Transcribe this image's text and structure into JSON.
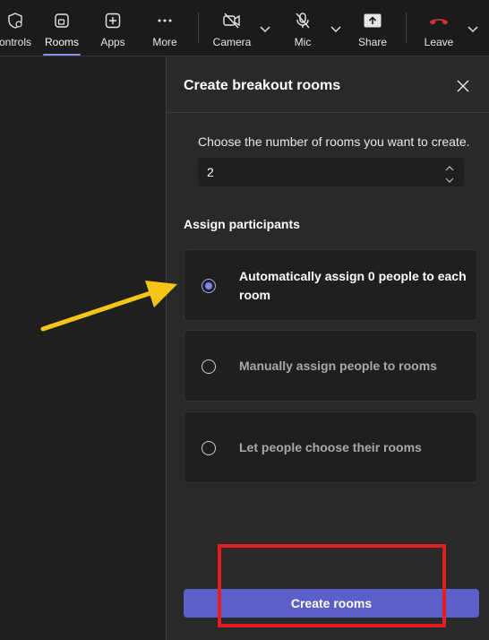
{
  "toolbar": {
    "items": [
      {
        "label": "ontrols",
        "icon": "shield-gear-icon"
      },
      {
        "label": "Rooms",
        "icon": "rooms-icon",
        "active": true
      },
      {
        "label": "Apps",
        "icon": "apps-plus-icon"
      },
      {
        "label": "More",
        "icon": "more-dots-icon"
      },
      {
        "label": "Camera",
        "icon": "camera-off-icon"
      },
      {
        "label": "Mic",
        "icon": "mic-off-icon"
      },
      {
        "label": "Share",
        "icon": "share-icon"
      },
      {
        "label": "Leave",
        "icon": "leave-phone-icon"
      }
    ]
  },
  "panel": {
    "title": "Create breakout rooms",
    "rooms_prompt": "Choose the number of rooms you want to create.",
    "rooms_value": "2",
    "assign_heading": "Assign participants",
    "options": [
      {
        "label": "Automatically assign 0 people to each room",
        "selected": true
      },
      {
        "label": "Manually assign people to rooms",
        "selected": false
      },
      {
        "label": "Let people choose their rooms",
        "selected": false
      }
    ],
    "create_label": "Create rooms"
  },
  "colors": {
    "accent": "#5b5fc7",
    "radio_selected": "#7f85f5",
    "leave_red": "#d13438",
    "annotation_arrow": "#f5c518",
    "annotation_box": "#e41e1e"
  }
}
